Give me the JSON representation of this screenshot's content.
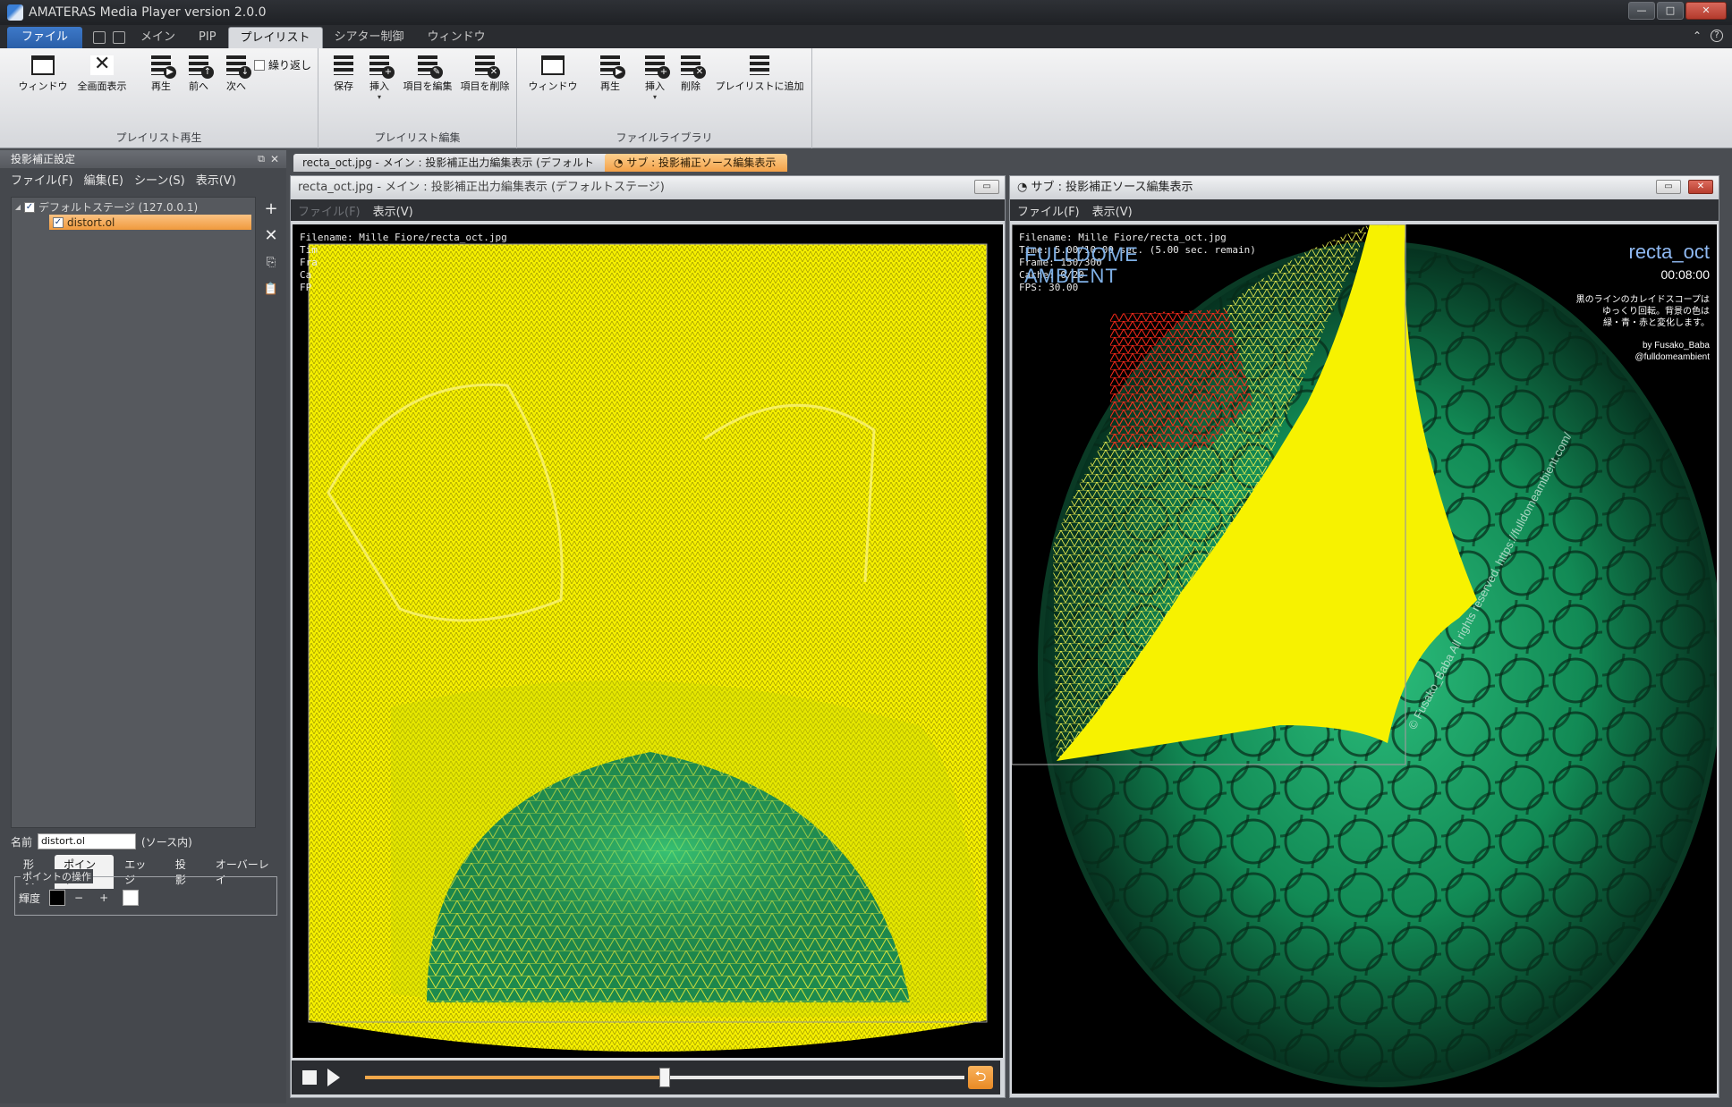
{
  "window": {
    "title": "AMATERAS Media Player version 2.0.0",
    "buttons": [
      "—",
      "□",
      "✕"
    ]
  },
  "ribbon_tabs": [
    "ファイル",
    "メイン",
    "PIP",
    "プレイリスト",
    "シアター制御",
    "ウィンドウ"
  ],
  "ribbon": {
    "groups": [
      {
        "label": "プレイリスト再生",
        "buttons": [
          "ウィンドウ",
          "全画面表示",
          "再生",
          "前へ",
          "次へ"
        ],
        "checkbox": "繰り返し"
      },
      {
        "label": "プレイリスト編集",
        "buttons": [
          "保存",
          "挿入",
          "項目を編集",
          "項目を削除"
        ]
      },
      {
        "label": "ファイルライブラリ",
        "buttons": [
          "ウィンドウ",
          "再生",
          "挿入",
          "削除",
          "プレイリストに追加"
        ]
      }
    ]
  },
  "left_panel": {
    "title": "投影補正設定",
    "menu": [
      "ファイル(F)",
      "編集(E)",
      "シーン(S)",
      "表示(V)"
    ],
    "tree": [
      {
        "label": "デフォルトステージ (127.0.0.1)",
        "checked": true
      },
      {
        "label": "distort.ol",
        "checked": true,
        "selected": true
      }
    ],
    "tools": [
      "+",
      "✕",
      "⎘",
      "📋"
    ],
    "name_label": "名前",
    "name_value": "distort.ol",
    "name_source": "(ソース内)",
    "prop_tabs": [
      "形状",
      "ポイント",
      "エッジ",
      "投影",
      "オーバーレイ"
    ],
    "point_ops": {
      "legend": "ポイントの操作",
      "lum_label": "輝度",
      "minus": "−",
      "plus": "+",
      "dark_color": "#000000",
      "light_color": "#ffffff"
    }
  },
  "doc_tabs": {
    "main": "recta_oct.jpg - メイン : 投影補正出力編集表示 (デフォルトステージ)",
    "sub": "サブ : 投影補正ソース編集表示"
  },
  "main_view": {
    "header": "recta_oct.jpg - メイン : 投影補正出力編集表示 (デフォルトステージ)",
    "menu": [
      "ファイル(F)",
      "表示(V)"
    ],
    "overlay": [
      "Filename: Mille Fiore/recta_oct.jpg",
      "Tim",
      "Fra",
      "Ca",
      "FP"
    ]
  },
  "sub_view": {
    "header": "サブ : 投影補正ソース編集表示",
    "menu": [
      "ファイル(F)",
      "表示(V)"
    ],
    "overlay": [
      "Filename: Mille Fiore/recta_oct.jpg",
      "Time: 5.00/10.00 sec. (5.00 sec. remain)",
      "Frame: 150/300",
      "Cache: 0/20",
      "FPS: 30.00"
    ],
    "brand_line1": "FULLDOME",
    "brand_line2": "AMBIENT",
    "work_title": "recta_oct",
    "duration": "00:08:00",
    "desc1": "黒のラインのカレイドスコープは",
    "desc2": "ゆっくり回転。背景の色は",
    "desc3": "緑・青・赤と変化します。",
    "credit1": "by Fusako_Baba",
    "credit2": "@fulldomeambient",
    "copyright": "© Fusako_Baba All rights reserved. https://fulldomeambient.com/"
  },
  "playback": {
    "progress": 0.5,
    "loop_icon": "⮌"
  }
}
